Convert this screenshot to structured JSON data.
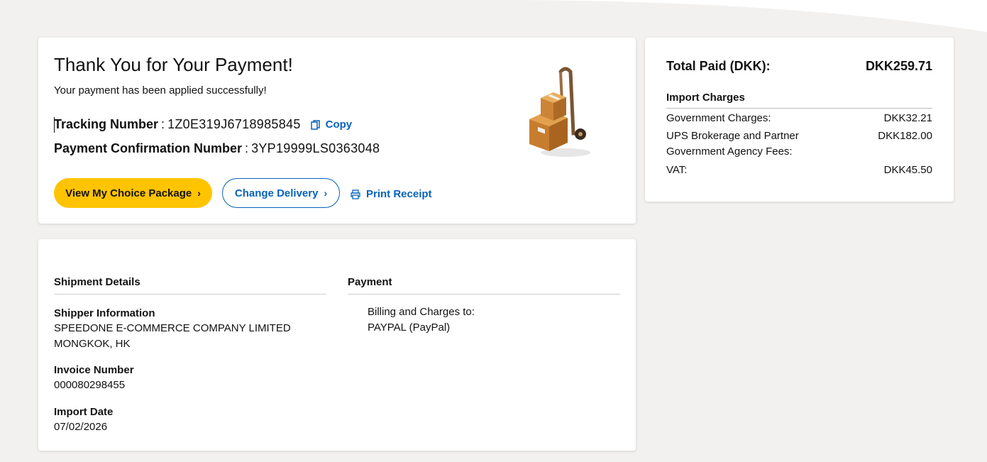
{
  "confirmation": {
    "title": "Thank You for Your Payment!",
    "subtitle": "Your payment has been applied successfully!",
    "tracking_label": "Tracking Number",
    "tracking_number": "1Z0E319J6718985845",
    "copy_label": "Copy",
    "payment_conf_label": "Payment Confirmation Number",
    "payment_conf_number": "3YP19999LS0363048",
    "separator": ":",
    "buttons": {
      "view_package": "View My Choice Package",
      "change_delivery": "Change Delivery",
      "print_receipt": "Print Receipt"
    }
  },
  "summary": {
    "total_label": "Total Paid (DKK):",
    "total_value": "DKK259.71",
    "import_charges_heading": "Import Charges",
    "charges": [
      {
        "label": "Government Charges:",
        "value": "DKK32.21"
      },
      {
        "label": "UPS Brokerage and Partner Government Agency Fees:",
        "value": "DKK182.00"
      },
      {
        "label": "VAT:",
        "value": "DKK45.50"
      }
    ]
  },
  "shipment": {
    "heading": "Shipment Details",
    "shipper_label": "Shipper Information",
    "shipper_name": "SPEEDONE E-COMMERCE COMPANY LIMITED",
    "shipper_location": "MONGKOK, HK",
    "invoice_label": "Invoice Number",
    "invoice_number": "000080298455",
    "import_date_label": "Import Date",
    "import_date": "07/02/2026"
  },
  "payment": {
    "heading": "Payment",
    "billing_label": "Billing and Charges to:",
    "billing_value": "PAYPAL (PayPal)"
  },
  "colors": {
    "accent_yellow": "#ffc400",
    "link_blue": "#0662bb",
    "background": "#f2f1ef"
  }
}
